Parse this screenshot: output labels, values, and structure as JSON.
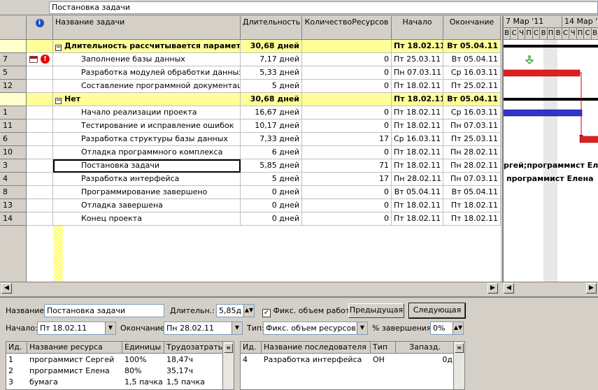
{
  "entry_bar": {
    "value": "Постановка задачи"
  },
  "columns": {
    "info_icon": "i",
    "name": "Название задачи",
    "duration": "Длительность",
    "resource_count": "КоличествоРесурсов",
    "start": "Начало",
    "finish": "Окончание"
  },
  "groups": [
    {
      "title": "Длительность рассчитывается параметриче",
      "duration": "30,68 дней",
      "start": "Пт 18.02.11",
      "finish": "Вт 05.04.11",
      "tasks": [
        {
          "id": "7",
          "name": "Заполнение базы данных",
          "duration": "7,17 дней",
          "count": "0",
          "start": "Пт 25.03.11",
          "finish": "Вт 05.04.11",
          "indicators": true
        },
        {
          "id": "5",
          "name": "Разработка модулей обработки данных",
          "duration": "5,33 дней",
          "count": "0",
          "start": "Пн 07.03.11",
          "finish": "Ср 16.03.11"
        },
        {
          "id": "12",
          "name": "Составление программной документации",
          "duration": "5 дней",
          "count": "0",
          "start": "Пт 18.02.11",
          "finish": "Пт 25.02.11"
        }
      ]
    },
    {
      "title": "Нет",
      "duration": "30,68 дней",
      "start": "Пт 18.02.11",
      "finish": "Вт 05.04.11",
      "tasks": [
        {
          "id": "1",
          "name": "Начало реализации проекта",
          "duration": "16,67 дней",
          "count": "0",
          "start": "Пт 18.02.11",
          "finish": "Ср 16.03.11"
        },
        {
          "id": "11",
          "name": "Тестирование и исправление ошибок",
          "duration": "10,17 дней",
          "count": "0",
          "start": "Пт 18.02.11",
          "finish": "Пн 07.03.11"
        },
        {
          "id": "6",
          "name": "Разработка структуры базы данных",
          "duration": "7,33 дней",
          "count": "17",
          "start": "Ср 16.03.11",
          "finish": "Пт 25.03.11"
        },
        {
          "id": "10",
          "name": "Отладка программного комплекса",
          "duration": "6 дней",
          "count": "0",
          "start": "Пт 18.02.11",
          "finish": "Пн 28.02.11"
        },
        {
          "id": "3",
          "name": "Постановка задачи",
          "duration": "5,85 дней",
          "count": "71",
          "start": "Пт 18.02.11",
          "finish": "Пн 28.02.11"
        },
        {
          "id": "4",
          "name": "Разработка интерфейса",
          "duration": "5 дней",
          "count": "17",
          "start": "Пн 28.02.11",
          "finish": "Пн 07.03.11"
        },
        {
          "id": "8",
          "name": "Программирование завершено",
          "duration": "0 дней",
          "count": "0",
          "start": "Вт 05.04.11",
          "finish": "Вт 05.04.11"
        },
        {
          "id": "13",
          "name": "Отладка завершена",
          "duration": "0 дней",
          "count": "0",
          "start": "Пт 18.02.11",
          "finish": "Пт 18.02.11"
        },
        {
          "id": "14",
          "name": "Конец проекта",
          "duration": "0 дней",
          "count": "0",
          "start": "Пт 18.02.11",
          "finish": "Пт 18.02.11"
        }
      ]
    }
  ],
  "gantt": {
    "weeks": [
      "7 Мар '11",
      "14 Мар '11"
    ],
    "days": [
      "В",
      "С",
      "Ч",
      "П",
      "С",
      "В",
      "П",
      "В",
      "С",
      "Ч",
      "П",
      "С",
      "В"
    ],
    "labels": [
      "ргей;программист Елена",
      "программист Елена"
    ],
    "colors": {
      "task_bar_red": "#e02020",
      "task_bar_blue": "#3333cc",
      "summary": "#000000",
      "link": "#cc0000",
      "milestone_arrow": "#008000"
    }
  },
  "form": {
    "name_label": "Название:",
    "name_value": "Постановка задачи",
    "duration_label": "Длительн.:",
    "duration_value": "5,85д",
    "effort_driven_label": "Фикс. объем работ",
    "effort_driven_checked": true,
    "prev_button": "Предыдущая",
    "next_button": "Следующая",
    "start_label": "Начало:",
    "start_value": "Пт 18.02.11",
    "finish_label": "Окончание:",
    "finish_value": "Пн 28.02.11",
    "type_label": "Тип:",
    "type_value": "Фикс. объем ресурсов",
    "complete_label": "% завершения:",
    "complete_value": "0%",
    "resources": {
      "headers": [
        "Ид.",
        "Название ресурса",
        "Единицы",
        "Трудозатраты"
      ],
      "rows": [
        [
          "1",
          "программист Сергей",
          "100%",
          "18,47ч"
        ],
        [
          "2",
          "программист Елена",
          "80%",
          "35,17ч"
        ],
        [
          "3",
          "бумага",
          "1,5 пачка",
          "1,5 пачка"
        ]
      ]
    },
    "successors": {
      "headers": [
        "Ид.",
        "Название последователя",
        "Тип",
        "Запазд."
      ],
      "rows": [
        [
          "4",
          "Разработка интерфейса",
          "ОН",
          "0д"
        ]
      ]
    }
  }
}
